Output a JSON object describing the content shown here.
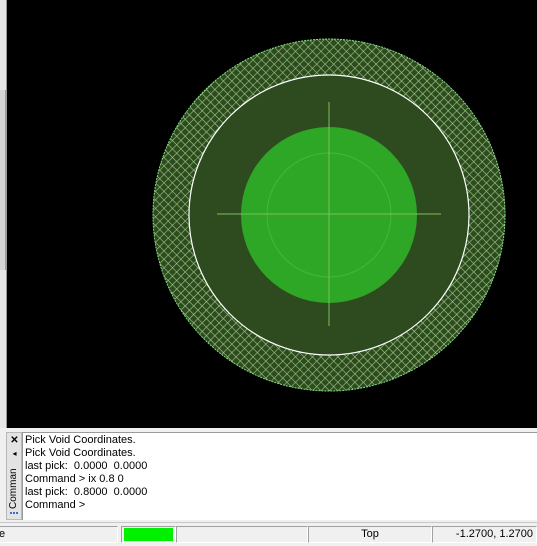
{
  "canvas": {
    "background": "#000000",
    "colors": {
      "outer_ring_fill": "#2e4a1f",
      "hatch_color": "#9fcf8a",
      "ring_outline": "#7fe07f",
      "void_boundary": "#ffffff",
      "pad_fill": "#2ea626",
      "inner_circle_stroke": "#44b83a",
      "crosshair": "#7fbf5a"
    }
  },
  "command_window": {
    "title": "Comman",
    "close_icon": "close-icon",
    "lines": [
      "Pick Void Coordinates.",
      "Pick Void Coordinates.",
      "last pick:  0.0000  0.0000",
      "Command > ix 0.8 0",
      "last pick:  0.8000  0.0000",
      "Command >"
    ]
  },
  "status_bar": {
    "message": "e",
    "color_swatch": "#00f000",
    "layer": "Top",
    "coordinates": "-1.2700, 1.2700"
  }
}
